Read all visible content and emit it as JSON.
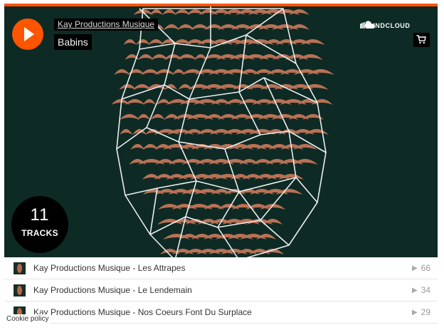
{
  "player": {
    "artist": "Kay Productions Musique",
    "playlist_title": "Babins",
    "brand": "SOUNDCLOUD",
    "track_count": "11",
    "track_count_label": "TRACKS",
    "accent_color": "#ff5500",
    "artwork_background_color": "#0e2a24",
    "artwork_art_color": "#c9785a"
  },
  "tracks": [
    {
      "title": "Kay Productions Musique - Les Attrapes",
      "plays": "66"
    },
    {
      "title": "Kay Productions Musique - Le Lendemain",
      "plays": "34"
    },
    {
      "title": "Kay Productions Musique - Nos Coeurs Font Du Surplace",
      "plays": "29"
    }
  ],
  "icons": {
    "play": "play-icon",
    "cloud": "soundcloud-logo-icon",
    "cart": "cart-icon",
    "play_count": "play-count-icon"
  },
  "cookie_policy": "Cookie policy"
}
